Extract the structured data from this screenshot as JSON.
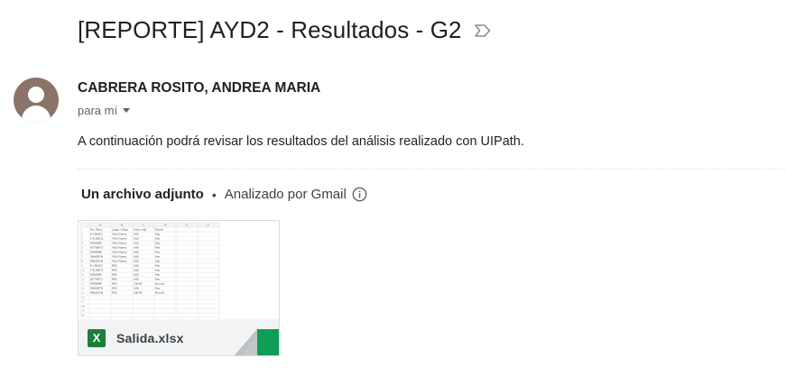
{
  "email": {
    "subject": "[REPORTE] AYD2 - Resultados - G2",
    "label_icon": "important-marker-icon",
    "sender": "CABRERA ROSITO, ANDREA MARIA",
    "recipient": "para mí",
    "body": "A continuación podrá revisar los resultados del análisis realizado con UIPath."
  },
  "attachments": {
    "count_label": "Un archivo adjunto",
    "separator": "•",
    "scanned_label": "Analizado por Gmail",
    "files": [
      {
        "name": "Salida.xlsx",
        "type_glyph": "X",
        "icon": "excel-icon"
      }
    ]
  },
  "spreadsheet_preview": {
    "columns": [
      "",
      "A",
      "B",
      "C",
      "D",
      "E",
      "F"
    ],
    "rows": [
      [
        "1",
        "No. Placa",
        "Lugar o Pago",
        "Valor total",
        "Estado",
        "",
        ""
      ],
      [
        "2",
        "P-1963LV",
        "Villa Nueva",
        "0.00",
        "Pen",
        "",
        ""
      ],
      [
        "3",
        "C413BCX",
        "Villa Nueva",
        "0.00",
        "Pen",
        "",
        ""
      ],
      [
        "4",
        "P950DPF",
        "Villa Nueva",
        "0.00",
        "Pen",
        "",
        ""
      ],
      [
        "5",
        "M770B73",
        "Villa Nueva",
        "0.00",
        "Pen",
        "",
        ""
      ],
      [
        "6",
        "P959DPF",
        "Villa Nueva",
        "0.00",
        "Pen",
        "",
        ""
      ],
      [
        "7",
        "M042B78",
        "Villa Nueva",
        "0.00",
        "Pen",
        "",
        ""
      ],
      [
        "8",
        "P802DVR",
        "Villa Nueva",
        "0.00",
        "Pen",
        "",
        ""
      ],
      [
        "9",
        "P-1963LV",
        "PNC",
        "0.00",
        "Pen",
        "",
        ""
      ],
      [
        "10",
        "C413BCX",
        "PNC",
        "0.00",
        "Pen",
        "",
        ""
      ],
      [
        "11",
        "P950DPF",
        "PNC",
        "0.00",
        "Pen",
        "",
        ""
      ],
      [
        "12",
        "M770B73",
        "PNC",
        "0.00",
        "Pen",
        "",
        ""
      ],
      [
        "13",
        "P959DPF",
        "PNC",
        "250.00",
        "Record",
        "",
        ""
      ],
      [
        "14",
        "M042B78",
        "PNC",
        "0.00",
        "Pen",
        "",
        ""
      ],
      [
        "15",
        "P802DVR",
        "PNC",
        "200.00",
        "Record",
        "",
        ""
      ],
      [
        "16",
        "",
        "",
        "",
        "",
        "",
        ""
      ],
      [
        "17",
        "",
        "",
        "",
        "",
        "",
        ""
      ],
      [
        "18",
        "",
        "",
        "",
        "",
        "",
        ""
      ],
      [
        "19",
        "",
        "",
        "",
        "",
        "",
        ""
      ],
      [
        "20",
        "",
        "",
        "",
        "",
        "",
        ""
      ]
    ]
  },
  "colors": {
    "excel_green": "#188038",
    "avatar_bg": "#8b7467",
    "footer_bg": "#f1f3f4"
  }
}
